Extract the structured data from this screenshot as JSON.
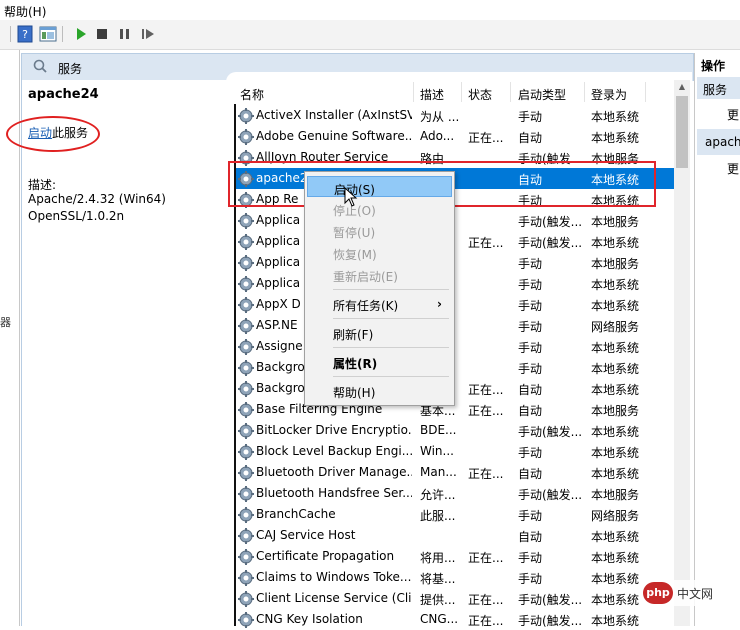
{
  "menubar": {
    "help": "帮助(H)"
  },
  "toolbar": {
    "icons": [
      "help-book-icon",
      "show-hide-pane-icon",
      "play-icon",
      "stop-icon",
      "pause-icon",
      "restart-icon"
    ]
  },
  "left_strip": {
    "text": "器"
  },
  "pane": {
    "title": "服务"
  },
  "details": {
    "service_name": "apache24",
    "start_link": "启动",
    "start_suffix": "此服务",
    "desc_label": "描述:",
    "desc_line1": "Apache/2.4.32 (Win64)",
    "desc_line2": "OpenSSL/1.0.2n"
  },
  "columns": {
    "name": "名称",
    "desc": "描述",
    "state": "状态",
    "startup": "启动类型",
    "logon": "登录为"
  },
  "rows": [
    {
      "name": "ActiveX Installer (AxInstSV)",
      "desc": "为从 ...",
      "state": "",
      "startup": "手动",
      "logon": "本地系统"
    },
    {
      "name": "Adobe Genuine Software...",
      "desc": "Ado...",
      "state": "正在...",
      "startup": "自动",
      "logon": "本地系统"
    },
    {
      "name": "AllJoyn Router Service",
      "desc": "路由...",
      "state": "",
      "startup": "手动(触发...",
      "logon": "本地服务"
    },
    {
      "name": "apache24",
      "desc": "",
      "state": "",
      "startup": "自动",
      "logon": "本地系统"
    },
    {
      "name": "App Re",
      "desc": "",
      "state": "",
      "startup": "手动",
      "logon": "本地系统"
    },
    {
      "name": "Applica",
      "desc": "",
      "state": "",
      "startup": "手动(触发...",
      "logon": "本地服务"
    },
    {
      "name": "Applica",
      "desc": "",
      "state": "正在...",
      "startup": "手动(触发...",
      "logon": "本地系统"
    },
    {
      "name": "Applica",
      "desc": "",
      "state": "",
      "startup": "手动",
      "logon": "本地服务"
    },
    {
      "name": "Applica",
      "desc": "",
      "state": "",
      "startup": "手动",
      "logon": "本地系统"
    },
    {
      "name": "AppX D",
      "desc": "",
      "state": "",
      "startup": "手动",
      "logon": "本地系统"
    },
    {
      "name": "ASP.NE",
      "desc": "",
      "state": "",
      "startup": "手动",
      "logon": "网络服务"
    },
    {
      "name": "Assigne",
      "desc": "",
      "state": "",
      "startup": "手动",
      "logon": "本地系统"
    },
    {
      "name": "Backgro",
      "desc": "",
      "state": "",
      "startup": "手动",
      "logon": "本地系统"
    },
    {
      "name": "Backgro",
      "desc": "",
      "state": "正在...",
      "startup": "自动",
      "logon": "本地系统"
    },
    {
      "name": "Base Filtering Engine",
      "desc": "基本...",
      "state": "正在...",
      "startup": "自动",
      "logon": "本地服务"
    },
    {
      "name": "BitLocker Drive Encryptio...",
      "desc": "BDE...",
      "state": "",
      "startup": "手动(触发...",
      "logon": "本地系统"
    },
    {
      "name": "Block Level Backup Engi...",
      "desc": "Win...",
      "state": "",
      "startup": "手动",
      "logon": "本地系统"
    },
    {
      "name": "Bluetooth Driver Manage...",
      "desc": "Man...",
      "state": "正在...",
      "startup": "自动",
      "logon": "本地系统"
    },
    {
      "name": "Bluetooth Handsfree Ser...",
      "desc": "允许...",
      "state": "",
      "startup": "手动(触发...",
      "logon": "本地服务"
    },
    {
      "name": "BranchCache",
      "desc": "此服...",
      "state": "",
      "startup": "手动",
      "logon": "网络服务"
    },
    {
      "name": "CAJ Service Host",
      "desc": "",
      "state": "",
      "startup": "自动",
      "logon": "本地系统"
    },
    {
      "name": "Certificate Propagation",
      "desc": "将用...",
      "state": "正在...",
      "startup": "手动",
      "logon": "本地系统"
    },
    {
      "name": "Claims to Windows Toke...",
      "desc": "将基...",
      "state": "",
      "startup": "手动",
      "logon": "本地系统"
    },
    {
      "name": "Client License Service (Cli...",
      "desc": "提供...",
      "state": "正在...",
      "startup": "手动(触发...",
      "logon": "本地系统"
    },
    {
      "name": "CNG Key Isolation",
      "desc": "CNG...",
      "state": "正在...",
      "startup": "手动(触发...",
      "logon": "本地系统"
    }
  ],
  "context_menu": {
    "start": "启动(S)",
    "stop": "停止(O)",
    "pause": "暂停(U)",
    "resume": "恢复(M)",
    "restart": "重新启动(E)",
    "all_tasks": "所有任务(K)",
    "refresh": "刷新(F)",
    "properties": "属性(R)",
    "help": "帮助(H)"
  },
  "actions": {
    "title": "操作",
    "header1": "服务",
    "header2": "apach",
    "more": "更"
  },
  "watermark": {
    "logo": "php",
    "text": "中文网"
  },
  "colors": {
    "selection": "#0078d7",
    "annotation": "#e0252b",
    "link": "#1a5fb4",
    "pane_header": "#dbe6f2"
  }
}
